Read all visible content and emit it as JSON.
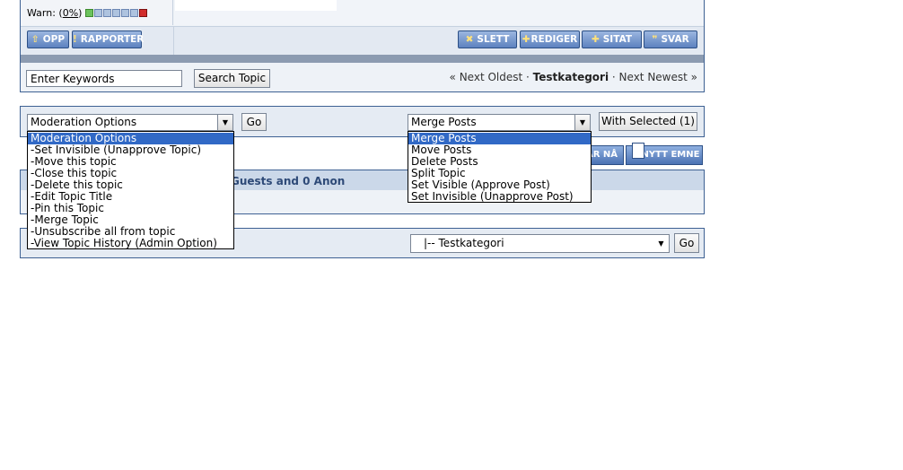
{
  "post": {
    "warn_prefix": "Warn: (",
    "warn_percent": "0%",
    "warn_suffix": ")",
    "warn_level": 0,
    "buttons": {
      "opp": "OPP",
      "rapporter": "RAPPORTER",
      "slett": "SLETT",
      "rediger": "REDIGER",
      "sitat": "SITAT",
      "svar": "SVAR"
    }
  },
  "search": {
    "keywords_value": "Enter Keywords",
    "button": "Search Topic"
  },
  "topic_nav": {
    "prev": "« Next Oldest",
    "sep1": " · ",
    "current": "Testkategori",
    "sep2": " · ",
    "next": "Next Newest »"
  },
  "moderation": {
    "selected": "Moderation Options",
    "go": "Go",
    "options": [
      "Moderation Options",
      "-Set Invisible (Unapprove Topic)",
      "-Move this topic",
      "-Close this topic",
      "-Delete this topic",
      "-Edit Topic Title",
      "-Pin this Topic",
      "-Merge Topic",
      "-Unsubscribe all from topic",
      "-View Topic History (Admin Option)"
    ]
  },
  "multi": {
    "selected": "Merge Posts",
    "with_selected": "With Selected (1)",
    "options": [
      "Merge Posts",
      "Move Posts",
      "Delete Posts",
      "Split Topic",
      "Set Visible (Approve Post)",
      "Set Invisible (Unapprove Post)"
    ]
  },
  "actions": {
    "reply_now": "AR NÅ",
    "new_topic": "NYTT EMNE"
  },
  "stats": {
    "text": "Guests and 0 Anon"
  },
  "jump": {
    "selected": "|-- Testkategori",
    "go": "Go"
  },
  "colors": {
    "border": "#3e6193",
    "highlight": "#3169c6",
    "button": "#5d82bf"
  }
}
